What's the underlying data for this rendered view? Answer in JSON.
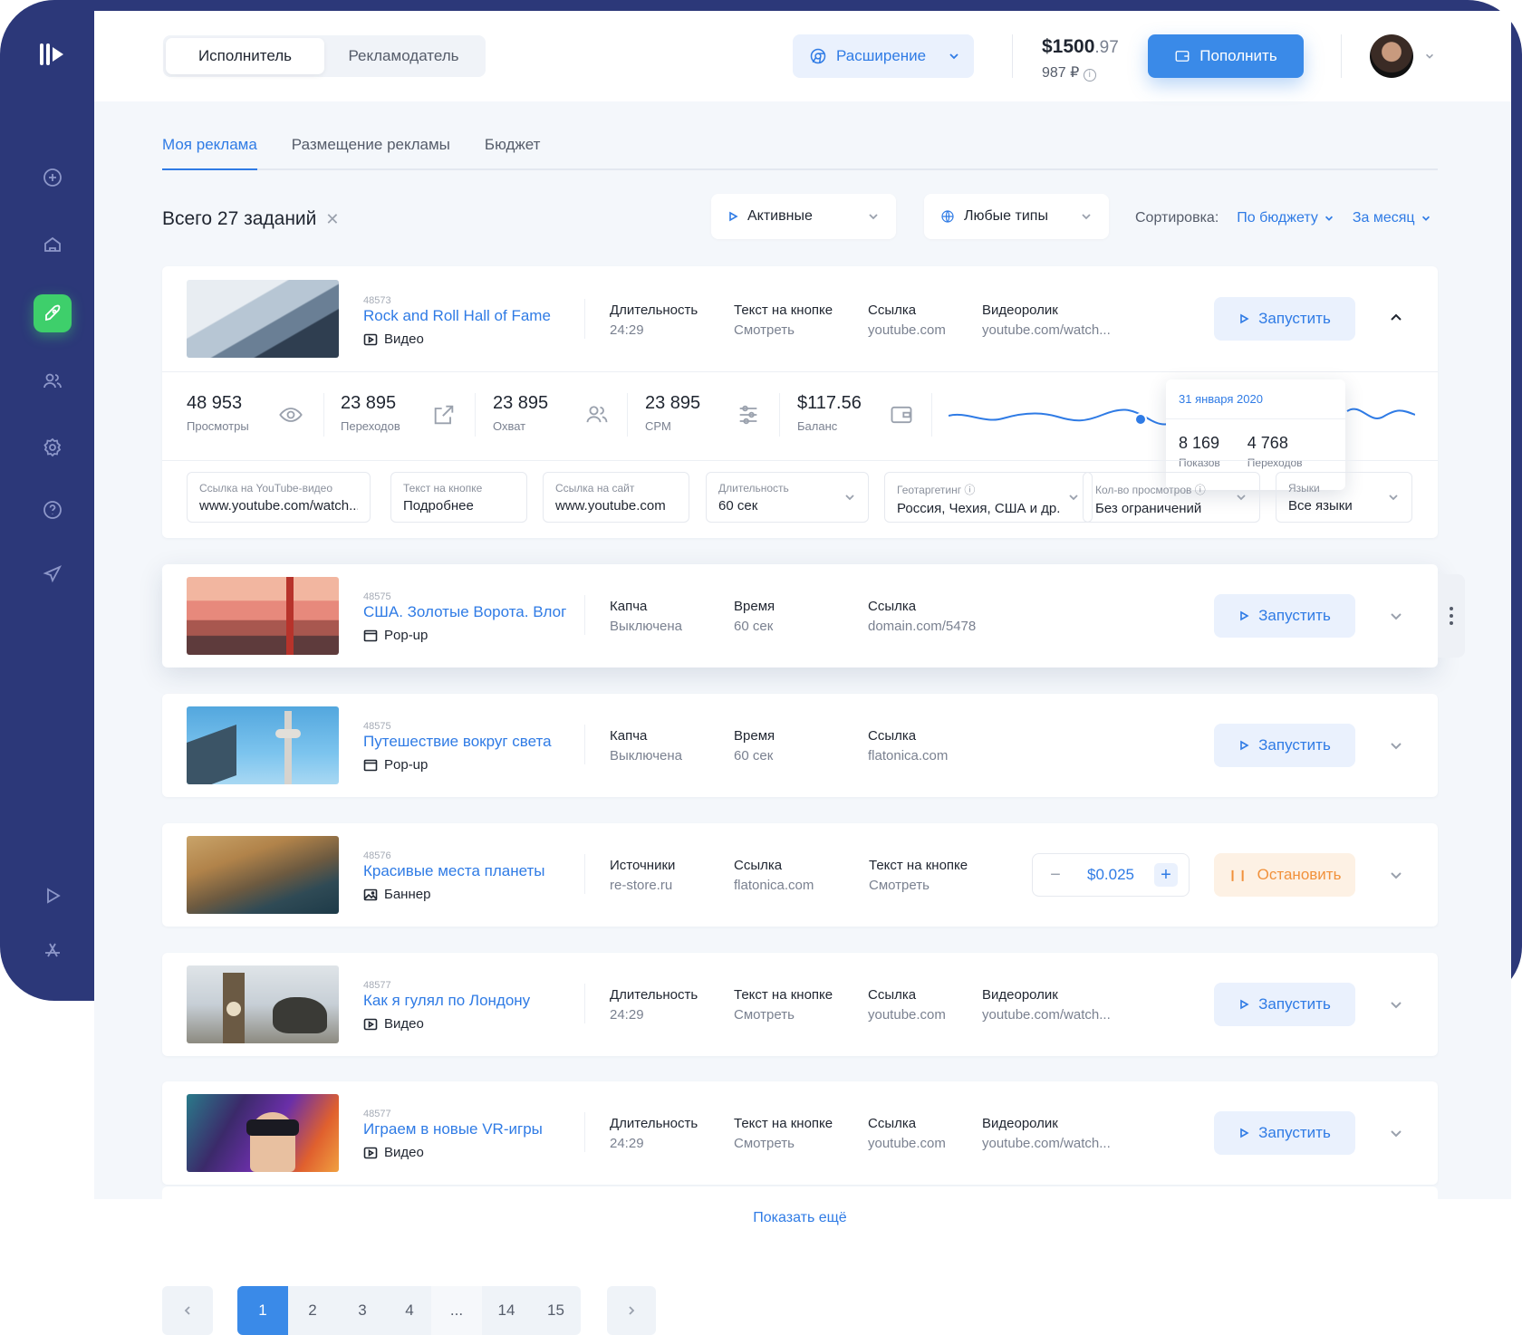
{
  "header": {
    "role_tabs": [
      "Исполнитель",
      "Рекламодатель"
    ],
    "extension_label": "Расширение",
    "balance_main": "$1500",
    "balance_cents": ".97",
    "balance_rub": "987 ₽",
    "topup_label": "Пополнить"
  },
  "tabs": [
    "Моя реклама",
    "Размещение рекламы",
    "Бюджет"
  ],
  "toolbar": {
    "total": "Всего 27 заданий",
    "filter_status": "Активные",
    "filter_type": "Любые типы",
    "sort_label": "Сортировка:",
    "sort_by": "По бюджету",
    "period": "За месяц"
  },
  "colors": {
    "accent": "#2f7be5",
    "sidebar": "#2c3879",
    "active_green": "#3ecf6b",
    "stop": "#f1913b"
  },
  "cards": [
    {
      "id": "48573",
      "title": "Rock and Roll Hall of Fame",
      "type": "Видео",
      "type_icon": "video-icon",
      "fields": [
        {
          "k": "Длительность",
          "v": "24:29"
        },
        {
          "k": "Текст на кнопке",
          "v": "Смотреть"
        },
        {
          "k": "Ссылка",
          "v": "youtube.com"
        },
        {
          "k": "Видеоролик",
          "v": "youtube.com/watch..."
        }
      ],
      "action": "Запустить",
      "expanded": true,
      "stats": [
        {
          "n": "48 953",
          "l": "Просмотры",
          "icon": "eye-icon"
        },
        {
          "n": "23 895",
          "l": "Переходов",
          "icon": "external-link-icon"
        },
        {
          "n": "23 895",
          "l": "Охват",
          "icon": "users-icon"
        },
        {
          "n": "23 895",
          "l": "CPM",
          "icon": "sliders-icon"
        },
        {
          "n": "$117.56",
          "l": "Баланс",
          "icon": "wallet-icon"
        }
      ],
      "tooltip": {
        "date": "31 января 2020",
        "shows": "8 169",
        "shows_label": "Показов",
        "clicks": "4 768",
        "clicks_label": "Переходов"
      },
      "settings": [
        {
          "k": "Ссылка на YouTube-видео",
          "v": "www.youtube.com/watch..."
        },
        {
          "k": "Текст на кнопке",
          "v": "Подробнее"
        },
        {
          "k": "Ссылка на сайт",
          "v": "www.youtube.com"
        },
        {
          "k": "Длительность",
          "v": "60 сек"
        },
        {
          "k": "Геотаргетинг ⓘ",
          "v": "Россия, Чехия, США и др."
        },
        {
          "k": "Кол-во просмотров ⓘ",
          "v": "Без ограничений"
        },
        {
          "k": "Языки",
          "v": "Все языки"
        }
      ]
    },
    {
      "id": "48575",
      "title": "США. Золотые Ворота. Влог",
      "type": "Pop-up",
      "type_icon": "popup-icon",
      "fields": [
        {
          "k": "Капча",
          "v": "Выключена"
        },
        {
          "k": "Время",
          "v": "60 сек"
        },
        {
          "k": "Ссылка",
          "v": "domain.com/5478"
        }
      ],
      "action": "Запустить"
    },
    {
      "id": "48575",
      "title": "Путешествие вокруг света",
      "type": "Pop-up",
      "type_icon": "popup-icon",
      "fields": [
        {
          "k": "Капча",
          "v": "Выключена"
        },
        {
          "k": "Время",
          "v": "60 сек"
        },
        {
          "k": "Ссылка",
          "v": "flatonica.com"
        }
      ],
      "action": "Запустить"
    },
    {
      "id": "48576",
      "title": "Красивые места планеты",
      "type": "Баннер",
      "type_icon": "image-icon",
      "fields": [
        {
          "k": "Источники",
          "v": "re-store.ru"
        },
        {
          "k": "Ссылка",
          "v": "flatonica.com"
        },
        {
          "k": "Текст на кнопке",
          "v": "Смотреть"
        }
      ],
      "price": "$0.025",
      "action": "Остановить"
    },
    {
      "id": "48577",
      "title": "Как я гулял по Лондону",
      "type": "Видео",
      "type_icon": "video-icon",
      "fields": [
        {
          "k": "Длительность",
          "v": "24:29"
        },
        {
          "k": "Текст на кнопке",
          "v": "Смотреть"
        },
        {
          "k": "Ссылка",
          "v": "youtube.com"
        },
        {
          "k": "Видеоролик",
          "v": "youtube.com/watch..."
        }
      ],
      "action": "Запустить"
    },
    {
      "id": "48577",
      "title": "Играем в новые VR-игры",
      "type": "Видео",
      "type_icon": "video-icon",
      "fields": [
        {
          "k": "Длительность",
          "v": "24:29"
        },
        {
          "k": "Текст на кнопке",
          "v": "Смотреть"
        },
        {
          "k": "Ссылка",
          "v": "youtube.com"
        },
        {
          "k": "Видеоролик",
          "v": "youtube.com/watch..."
        }
      ],
      "action": "Запустить"
    }
  ],
  "show_more": "Показать ещё",
  "pagination": {
    "pages": [
      "1",
      "2",
      "3",
      "4",
      "...",
      "14",
      "15"
    ],
    "current": "1"
  }
}
